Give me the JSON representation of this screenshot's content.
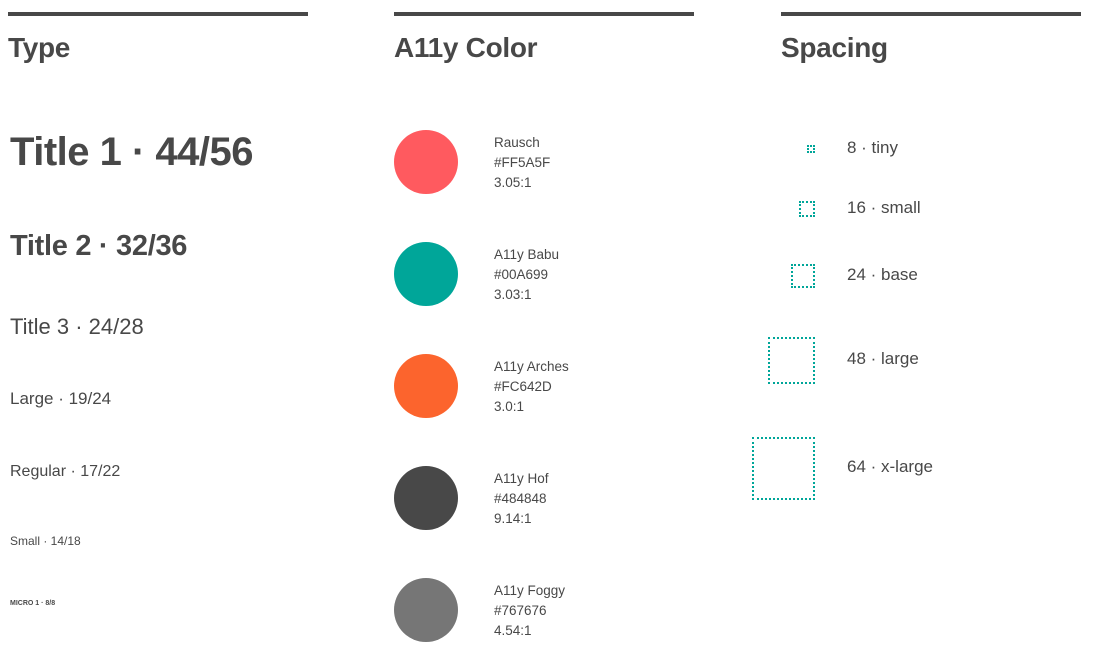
{
  "sections": {
    "type": {
      "title": "Type"
    },
    "color": {
      "title": "A11y Color"
    },
    "spacing": {
      "title": "Spacing"
    }
  },
  "type_scale": [
    {
      "label": "Title 1 · 44/56"
    },
    {
      "label": "Title 2 · 32/36"
    },
    {
      "label": "Title 3 · 24/28"
    },
    {
      "label": "Large · 19/24"
    },
    {
      "label": "Regular · 17/22"
    },
    {
      "label": "Small · 14/18"
    },
    {
      "label": "MICRO 1 · 8/8"
    }
  ],
  "colors": [
    {
      "name": "Rausch",
      "hex": "#FF5A5F",
      "ratio": "3.05:1"
    },
    {
      "name": "A11y Babu",
      "hex": "#00A699",
      "ratio": "3.03:1"
    },
    {
      "name": "A11y Arches",
      "hex": "#FC642D",
      "ratio": "3.0:1"
    },
    {
      "name": "A11y Hof",
      "hex": "#484848",
      "ratio": "9.14:1"
    },
    {
      "name": "A11y Foggy",
      "hex": "#767676",
      "ratio": "4.54:1"
    }
  ],
  "spacing": [
    {
      "value": 8,
      "label": "8 · tiny"
    },
    {
      "value": 16,
      "label": "16 · small"
    },
    {
      "value": 24,
      "label": "24 · base"
    },
    {
      "value": 48,
      "label": "48 · large"
    },
    {
      "value": 64,
      "label": "64 · x-large"
    }
  ],
  "theme": {
    "text": "#484848",
    "accent": "#00A699"
  }
}
